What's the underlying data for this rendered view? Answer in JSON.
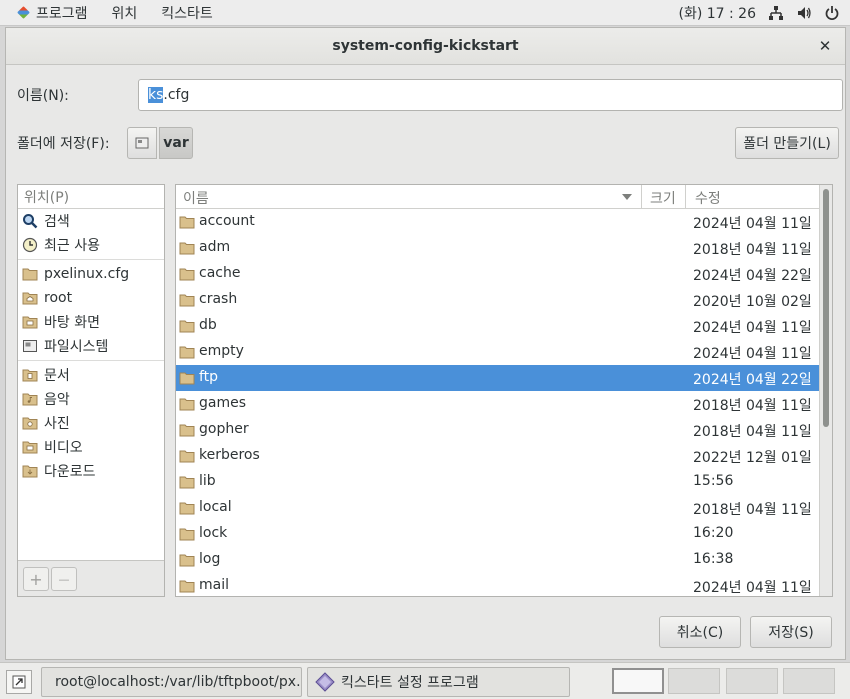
{
  "topbar": {
    "apps_menu": "프로그램",
    "places_menu": "위치",
    "app_menu": "킥스타트",
    "clock": "(화) 17 : 26",
    "icons": [
      "network-icon",
      "volume-icon",
      "power-icon"
    ]
  },
  "dialog": {
    "title": "system-config-kickstart",
    "name_label": "이름(N):",
    "filename_selected": "ks",
    "filename_rest": ".cfg",
    "save_in_label": "폴더에 저장(F):",
    "path_current": "var",
    "new_folder_label": "폴더 만들기(L)",
    "cancel_label": "취소(C)",
    "save_label": "저장(S)"
  },
  "places": {
    "header": "위치(P)",
    "items": [
      {
        "label": "검색",
        "icon": "search-icon"
      },
      {
        "label": "최근 사용",
        "icon": "recent-icon"
      },
      {
        "label": "pxelinux.cfg",
        "icon": "folder-icon"
      },
      {
        "label": "root",
        "icon": "home-folder-icon"
      },
      {
        "label": "바탕 화면",
        "icon": "desktop-folder-icon"
      },
      {
        "label": "파일시스템",
        "icon": "filesystem-icon"
      },
      {
        "label": "문서",
        "icon": "documents-folder-icon"
      },
      {
        "label": "음악",
        "icon": "music-folder-icon"
      },
      {
        "label": "사진",
        "icon": "pictures-folder-icon"
      },
      {
        "label": "비디오",
        "icon": "videos-folder-icon"
      },
      {
        "label": "다운로드",
        "icon": "downloads-folder-icon"
      }
    ]
  },
  "filelist": {
    "col_name": "이름",
    "col_size": "크기",
    "col_modified": "수정",
    "rows": [
      {
        "name": "account",
        "modified": "2024년 04월 11일"
      },
      {
        "name": "adm",
        "modified": "2018년 04월 11일"
      },
      {
        "name": "cache",
        "modified": "2024년 04월 22일"
      },
      {
        "name": "crash",
        "modified": "2020년 10월 02일"
      },
      {
        "name": "db",
        "modified": "2024년 04월 11일"
      },
      {
        "name": "empty",
        "modified": "2024년 04월 11일"
      },
      {
        "name": "ftp",
        "modified": "2024년 04월 22일",
        "selected": true
      },
      {
        "name": "games",
        "modified": "2018년 04월 11일"
      },
      {
        "name": "gopher",
        "modified": "2018년 04월 11일"
      },
      {
        "name": "kerberos",
        "modified": "2022년 12월 01일"
      },
      {
        "name": "lib",
        "modified": "15:56"
      },
      {
        "name": "local",
        "modified": "2018년 04월 11일"
      },
      {
        "name": "lock",
        "modified": "16:20"
      },
      {
        "name": "log",
        "modified": "16:38"
      },
      {
        "name": "mail",
        "modified": "2024년 04월 11일"
      }
    ]
  },
  "taskbar": {
    "terminal_title": "root@localhost:/var/lib/tftpboot/px…",
    "kickstart_title": "킥스타트 설정 프로그램"
  },
  "colors": {
    "selection": "#4a90d9",
    "folder": "#c9a86a"
  }
}
